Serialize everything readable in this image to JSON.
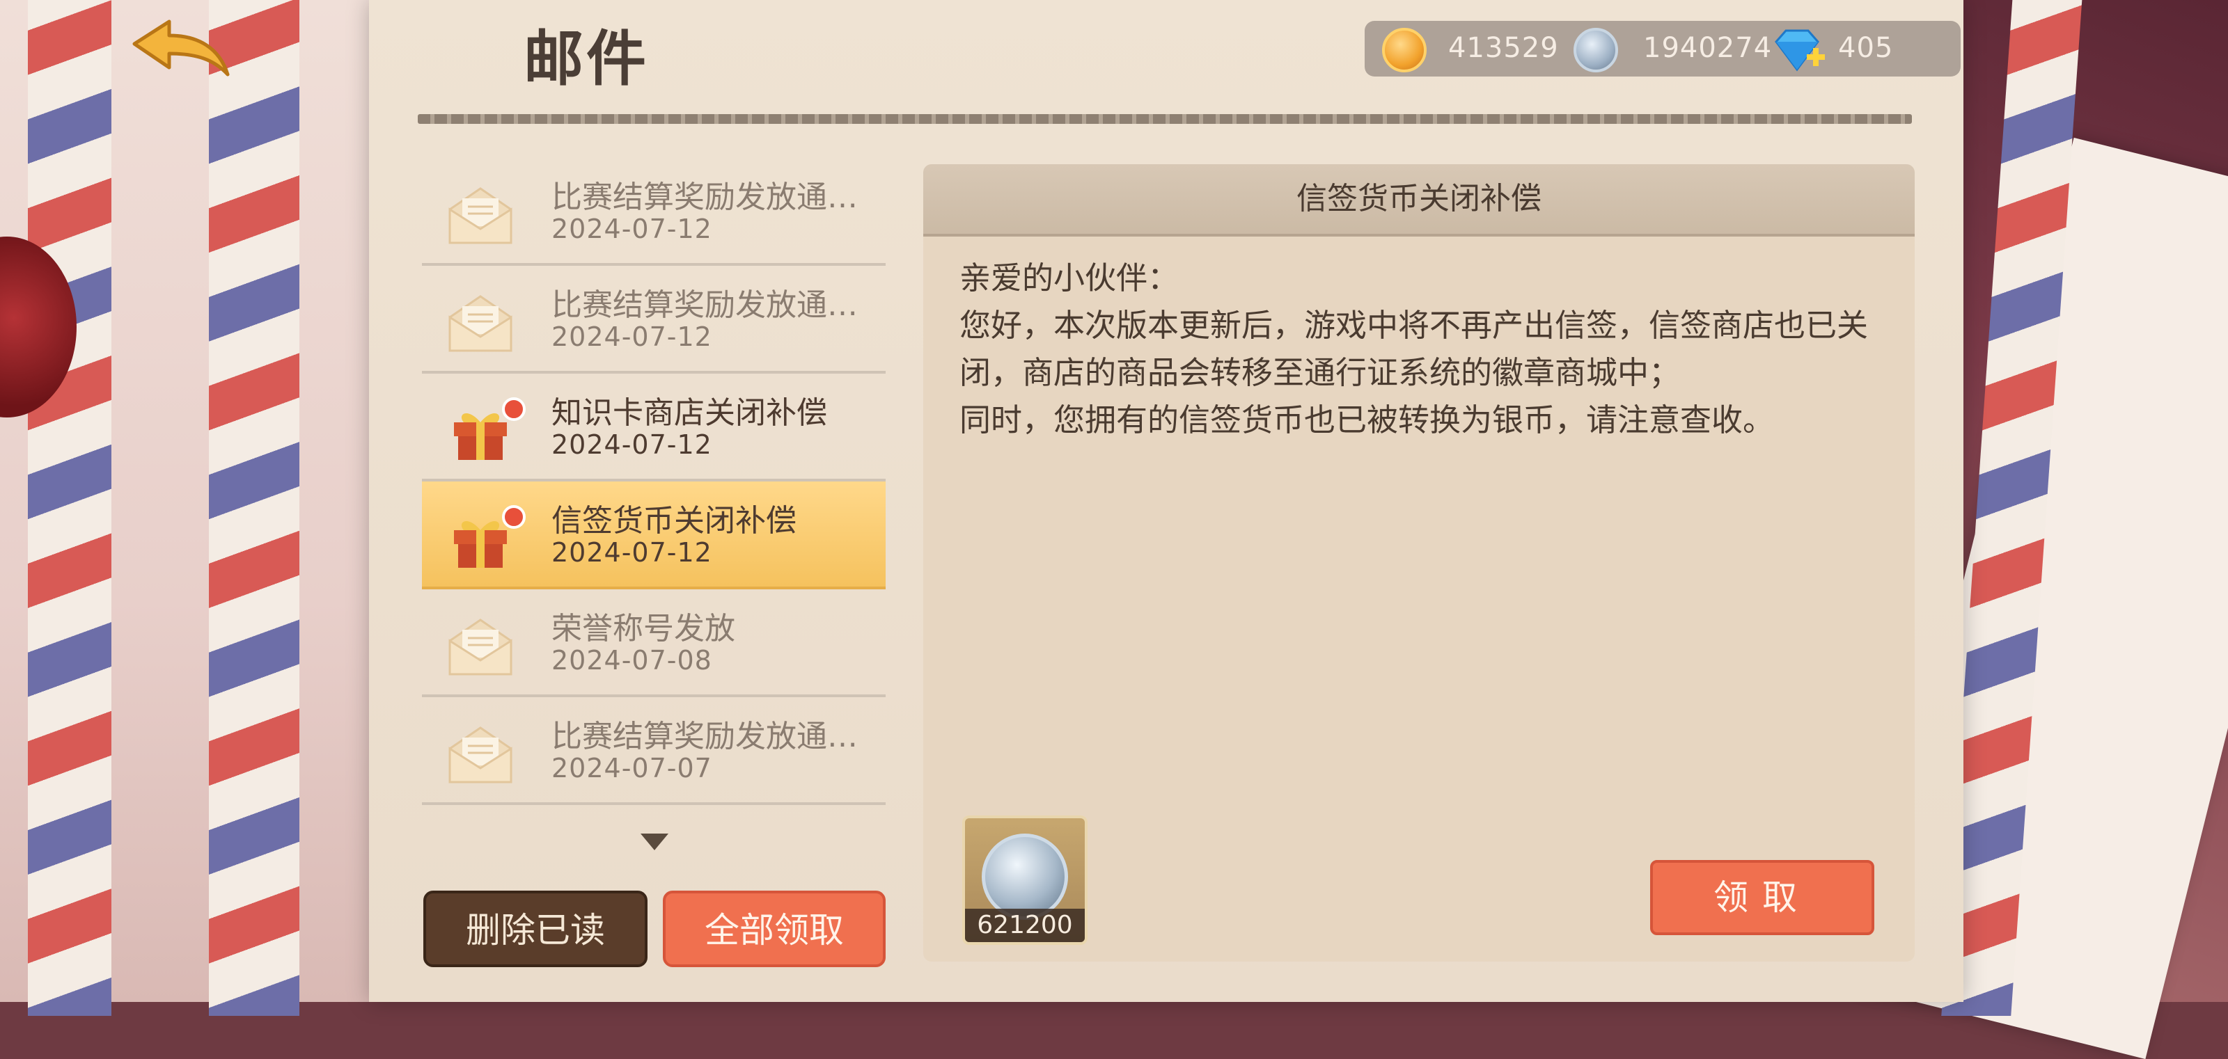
{
  "header": {
    "title": "邮件",
    "currency": {
      "gold": "413529",
      "silver": "1940274",
      "gems": "405"
    }
  },
  "mail_list": {
    "items": [
      {
        "subject": "比赛结算奖励发放通…",
        "date": "2024-07-12",
        "type": "envelope",
        "unread": false
      },
      {
        "subject": "比赛结算奖励发放通…",
        "date": "2024-07-12",
        "type": "envelope",
        "unread": false
      },
      {
        "subject": "知识卡商店关闭补偿",
        "date": "2024-07-12",
        "type": "gift",
        "unread": true
      },
      {
        "subject": "信签货币关闭补偿",
        "date": "2024-07-12",
        "type": "gift",
        "unread": true,
        "selected": true
      },
      {
        "subject": "荣誉称号发放",
        "date": "2024-07-08",
        "type": "envelope",
        "unread": false
      },
      {
        "subject": "比赛结算奖励发放通…",
        "date": "2024-07-07",
        "type": "envelope",
        "unread": false
      }
    ],
    "delete_read_label": "删除已读",
    "claim_all_label": "全部领取"
  },
  "detail": {
    "title": "信签货币关闭补偿",
    "greeting": "亲爱的小伙伴：",
    "body": "您好，本次版本更新后，游戏中将不再产出信签，信签商店也已关闭，商店的商品会转移至通行证系统的徽章商城中；",
    "body2": "同时，您拥有的信签货币也已被转换为银币，请注意查收。",
    "reward_count": "621200",
    "claim_label": "领取"
  },
  "colors": {
    "accent_button": "#f0704f",
    "dark_button": "#5a3d2a",
    "selected_row": "#f5c25e",
    "unread_dot": "#e8503a"
  }
}
